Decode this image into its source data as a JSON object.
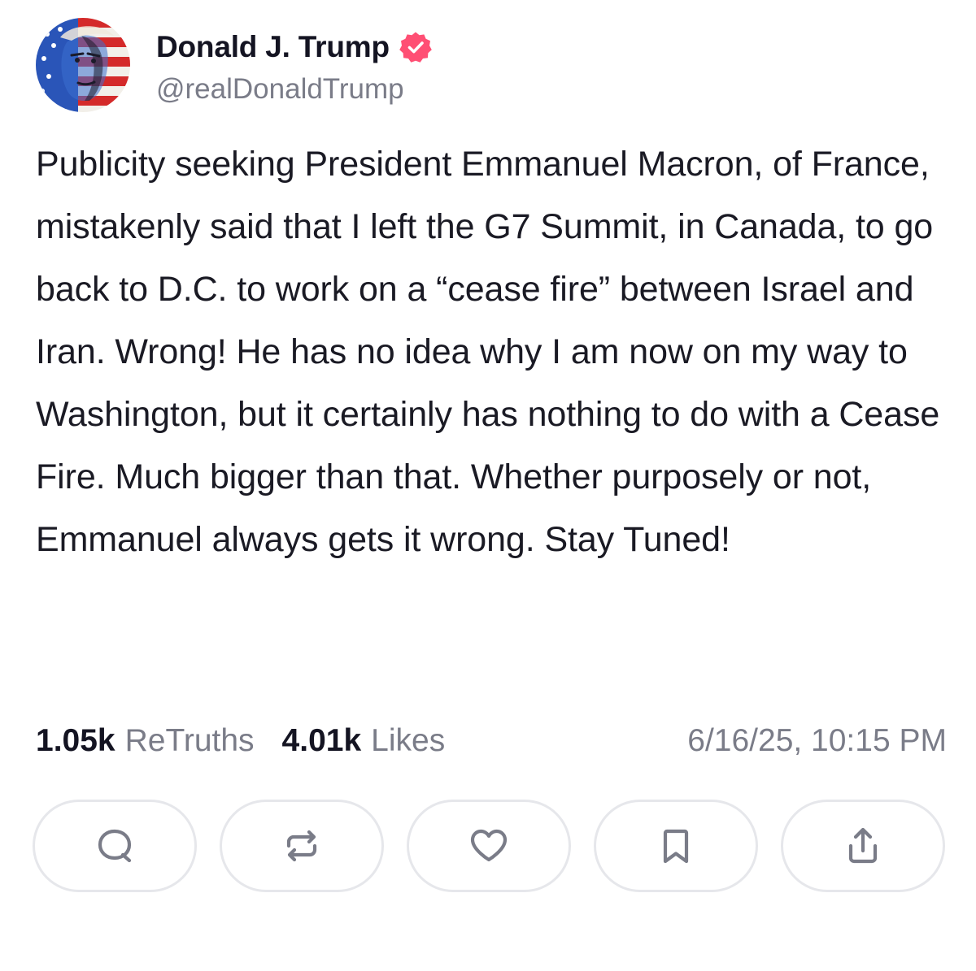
{
  "colors": {
    "text": "#1a1a24",
    "muted": "#7a7c88",
    "verified_badge": "#ff4f74",
    "button_border": "#e6e7eb"
  },
  "author": {
    "display_name": "Donald J. Trump",
    "handle": "@realDonaldTrump",
    "verified": true,
    "avatar_icon": "flag-portrait-avatar"
  },
  "post": {
    "text": "Publicity seeking President Emmanuel Macron, of France, mistakenly said that I left the G7 Summit, in Canada, to go back to D.C. to work on a “cease fire” between Israel and Iran. Wrong! He has no idea why I am now on my way to Washington, but it certainly has nothing to do with a Cease Fire. Much bigger than that. Whether purposely or not, Emmanuel always gets it wrong. Stay Tuned!"
  },
  "stats": {
    "retruths_count": "1.05k",
    "retruths_label": "ReTruths",
    "likes_count": "4.01k",
    "likes_label": "Likes",
    "timestamp": "6/16/25, 10:15 PM"
  },
  "actions": [
    {
      "icon": "reply-icon"
    },
    {
      "icon": "retruth-icon"
    },
    {
      "icon": "like-heart-icon"
    },
    {
      "icon": "bookmark-icon"
    },
    {
      "icon": "share-icon"
    }
  ]
}
